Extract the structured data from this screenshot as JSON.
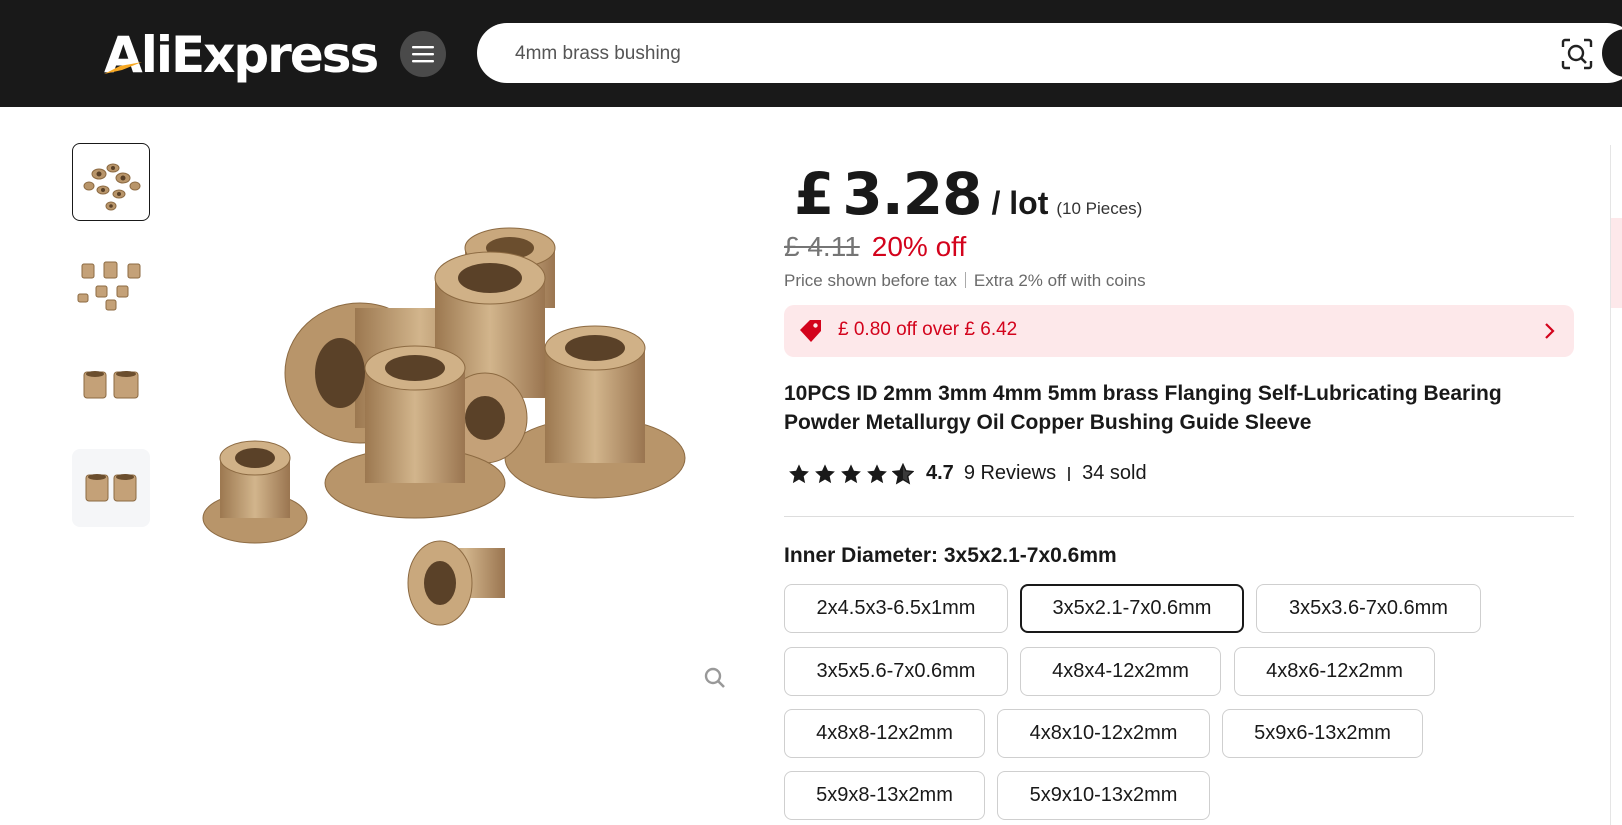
{
  "header": {
    "logo_text": "AliExpress",
    "menu_icon": "hamburger-menu-icon",
    "search": {
      "value": "4mm brass bushing",
      "placeholder": ""
    },
    "camera_icon": "camera-search-icon"
  },
  "gallery": {
    "thumbnails": [
      "bushing-set-photo",
      "bushing-grid-photo",
      "bushing-pair-photo",
      "bushing-pair-photo-2"
    ],
    "selected_index": 0,
    "zoom_icon": "zoom-icon"
  },
  "product": {
    "currency_symbol": "£",
    "price": "3.28",
    "price_unit": "/ lot",
    "pieces": "(10 Pieces)",
    "original_price": "£ 4.11",
    "discount": "20% off",
    "tax_note": "Price shown before tax",
    "coins_note": "Extra 2% off with coins",
    "coupon": "£ 0.80 off over  £ 6.42",
    "title": "10PCS ID 2mm 3mm 4mm 5mm brass Flanging Self-Lubricating Bearing Powder Metallurgy Oil Copper Bushing Guide Sleeve",
    "rating": "4.7",
    "stars": 4.7,
    "reviews": "9 Reviews",
    "sold": "34 sold"
  },
  "variants": {
    "label": "Inner Diameter: 3x5x2.1-7x0.6mm",
    "selected": "3x5x2.1-7x0.6mm",
    "options": [
      "2x4.5x3-6.5x1mm",
      "3x5x2.1-7x0.6mm",
      "3x5x3.6-7x0.6mm",
      "3x5x5.6-7x0.6mm",
      "4x8x4-12x2mm",
      "4x8x6-12x2mm",
      "4x8x8-12x2mm",
      "4x8x10-12x2mm",
      "5x9x6-13x2mm",
      "5x9x8-13x2mm",
      "5x9x10-13x2mm"
    ]
  },
  "colors": {
    "header_bg": "#191919",
    "accent_red": "#d3031c",
    "coupon_bg": "#fde8ea",
    "logo_swoosh": "#f7a823"
  }
}
